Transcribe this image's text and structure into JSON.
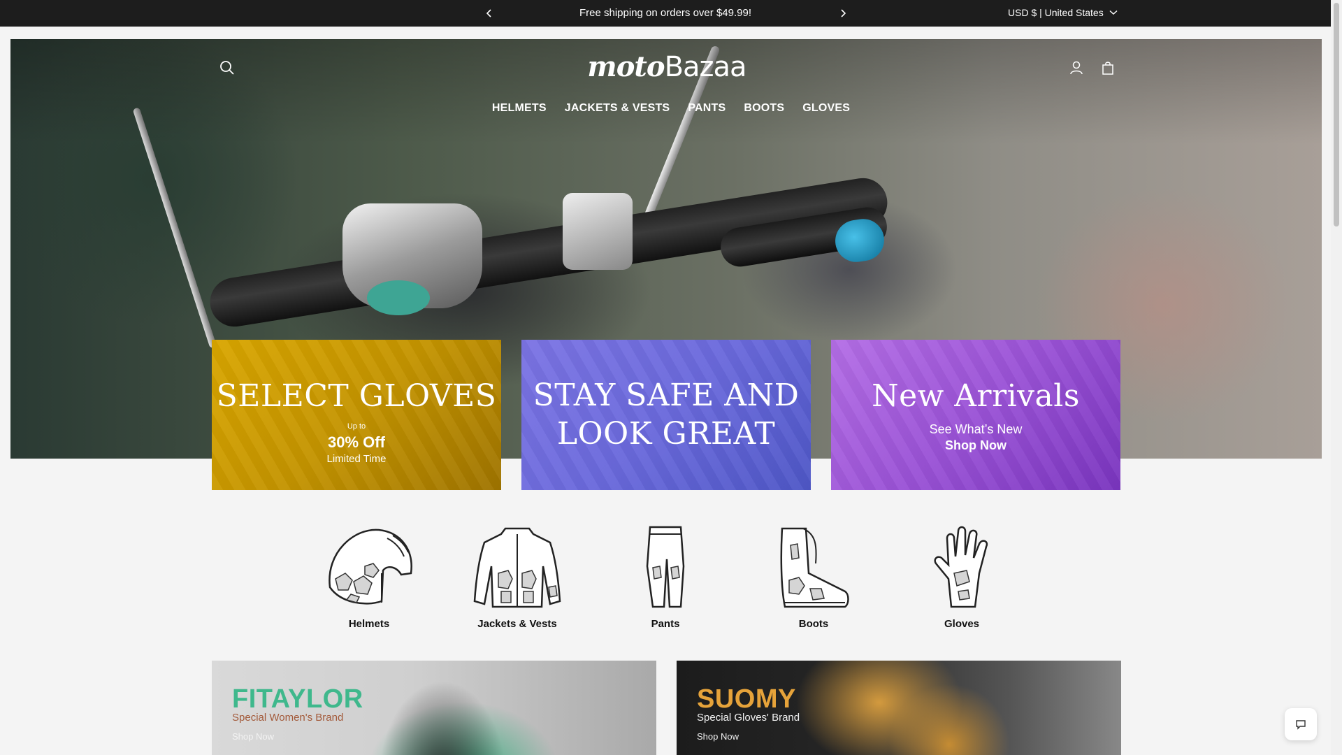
{
  "announcement": {
    "message": "Free shipping on orders over $49.99!",
    "currency": "USD $ | United States"
  },
  "header": {
    "logo_part1": "moto",
    "logo_part2": "Bazaa",
    "nav": [
      "HELMETS",
      "JACKETS & VESTS",
      "PANTS",
      "BOOTS",
      "GLOVES"
    ]
  },
  "promos": [
    {
      "title": "SELECT GLOVES",
      "small": "Up to",
      "big": "30% Off",
      "sub": "Limited Time"
    },
    {
      "title_line1": "STAY SAFE AND",
      "title_line2": "LOOK GREAT"
    },
    {
      "title": "New Arrivals",
      "sub1": "See What’s New",
      "sub2": "Shop Now"
    }
  ],
  "categories": [
    "Helmets",
    "Jackets & Vests",
    "Pants",
    "Boots",
    "Gloves"
  ],
  "brands": [
    {
      "name": "FITAYLOR",
      "tag": "Special Women's Brand",
      "shop": "Shop Now",
      "accent": "#3fb88c"
    },
    {
      "name": "SUOMY",
      "tag": "Special Gloves' Brand",
      "shop": "Shop Now",
      "accent": "#e6a33a"
    }
  ],
  "colors": {
    "announcement_bg": "#1d1d1d",
    "promo_gold": "#c49400",
    "promo_blue": "#6a69dc",
    "promo_purple": "#9a52d6"
  },
  "icons": {
    "prev": "chevron-left-icon",
    "next": "chevron-right-icon",
    "currency": "chevron-down-icon",
    "search": "search-icon",
    "account": "user-icon",
    "cart": "cart-icon",
    "chat": "chat-icon"
  }
}
